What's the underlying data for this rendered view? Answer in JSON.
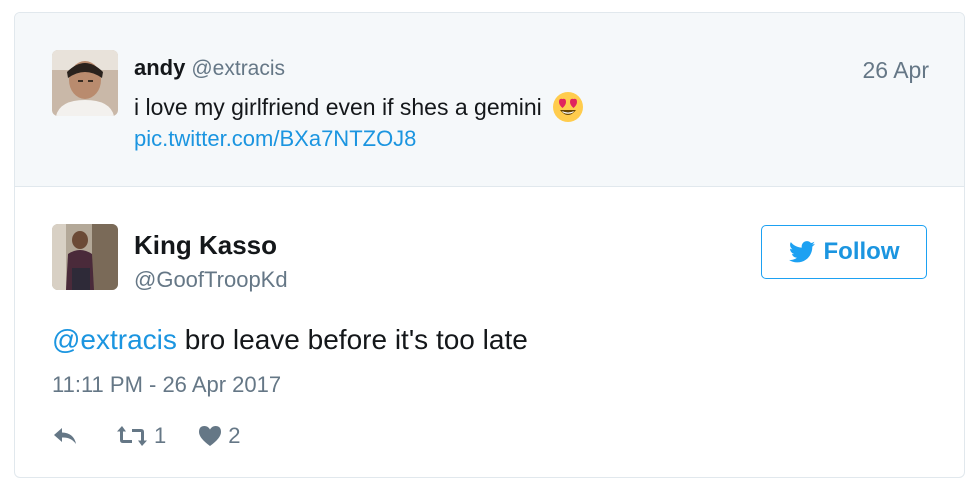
{
  "parent_tweet": {
    "name": "andy",
    "handle": "@extracis",
    "date": "26 Apr",
    "text": "i love my girlfriend even if shes a gemini",
    "emoji": "heart-eyes-emoji",
    "link": "pic.twitter.com/BXa7NTZOJ8"
  },
  "reply_tweet": {
    "name": "King Kasso",
    "handle": "@GoofTroopKd",
    "follow_label": "Follow",
    "mention": "@extracis",
    "text": "bro leave before it's too late",
    "timestamp": "11:11 PM - 26 Apr 2017",
    "retweet_count": "1",
    "like_count": "2"
  },
  "colors": {
    "link": "#1b95e0",
    "muted": "#657786",
    "parent_bg": "#f5f8fa",
    "border": "#e1e8ed"
  }
}
